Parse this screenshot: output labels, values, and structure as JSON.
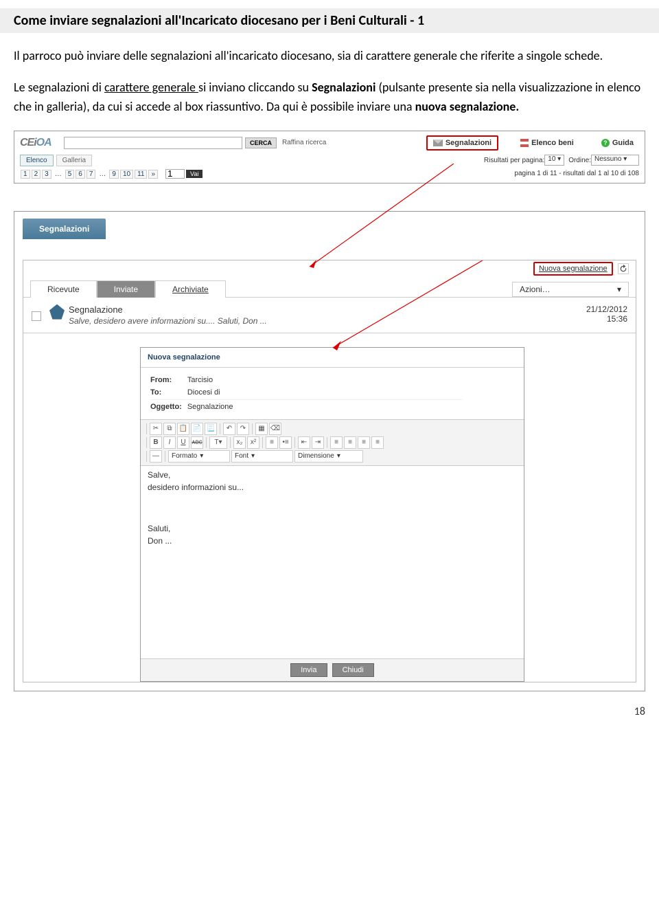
{
  "title": "Come inviare segnalazioni all'Incaricato diocesano per i Beni Culturali - 1",
  "para1a": "Il parroco può inviare delle segnalazioni all'incaricato diocesano, sia di carattere generale che riferite a singole schede.",
  "para2a": "Le segnalazioni di ",
  "para2u": "carattere generale ",
  "para2b": "si inviano cliccando su ",
  "para2bold": "Segnalazioni",
  "para2c": " (pulsante presente sia nella visualizzazione in elenco che in galleria), da cui si accede al box riassuntivo. Da qui è possibile inviare una ",
  "para2bold2": "nuova segnalazione.",
  "topbar": {
    "logo1": "CEi",
    "logo2": "OA",
    "cerca": "CERCA",
    "raffina": "Raffina ricerca",
    "segnalazioni": "Segnalazioni",
    "elenco_beni": "Elenco beni",
    "guida": "Guida",
    "elenco_tab": "Elenco",
    "galleria_tab": "Galleria",
    "perpage_label": "Risultati per pagina:",
    "perpage_val": "10",
    "ordine_label": "Ordine:",
    "ordine_val": "Nessuno",
    "p1": "1",
    "p2": "2",
    "p3": "3",
    "dots": "…",
    "p5": "5",
    "p6": "6",
    "p7": "7",
    "p9": "9",
    "p10": "10",
    "p11": "11",
    "next": "»",
    "go_val": "1",
    "vai": "Vai",
    "result_info": "pagina 1 di 11 - risultati dal 1 al 10 di 108"
  },
  "panel": {
    "segn_title": "Segnalazioni",
    "nuova": "Nuova segnalazione",
    "tab_ricevute": "Ricevute",
    "tab_inviate": "Inviate",
    "tab_archiviate": "Archiviate",
    "azioni": "Azioni…",
    "msg_title": "Segnalazione",
    "msg_preview": "Salve, desidero avere informazioni su.... Saluti, Don ...",
    "msg_date": "21/12/2012",
    "msg_time": "15:36"
  },
  "editor": {
    "title": "Nuova segnalazione",
    "from_lbl": "From:",
    "from_val": "Tarcisio",
    "to_lbl": "To:",
    "to_val": "Diocesi di",
    "oggetto_lbl": "Oggetto:",
    "oggetto_val": "Segnalazione",
    "formato": "Formato",
    "font": "Font",
    "dimensione": "Dimensione",
    "body1": "Salve,",
    "body2": "desidero informazioni su...",
    "body3": "Saluti,",
    "body4": "Don ...",
    "invia": "Invia",
    "chiudi": "Chiudi"
  },
  "page_num": "18"
}
